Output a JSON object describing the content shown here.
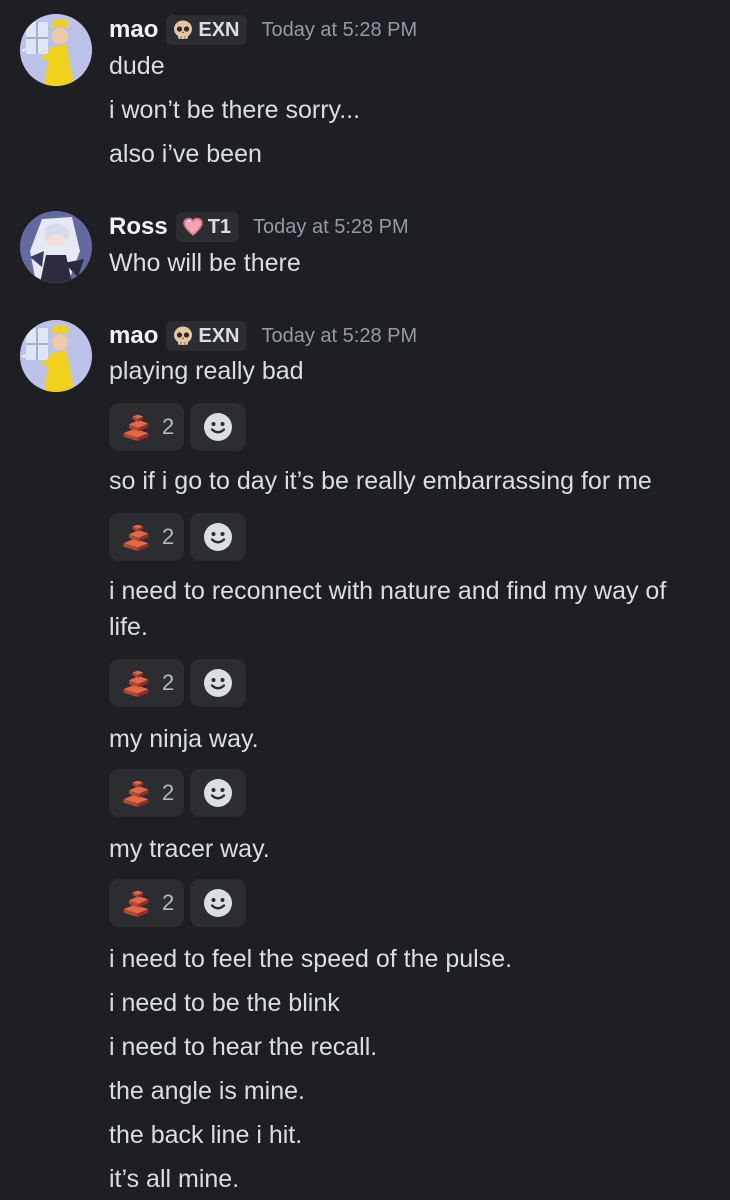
{
  "groups": [
    {
      "username": "mao",
      "tag": "EXN",
      "tag_icon": "skull-icon",
      "timestamp": "Today at 5:28 PM",
      "messages": [
        "dude",
        "i won’t be there sorry...",
        "also i’ve been"
      ]
    },
    {
      "username": "Ross",
      "tag": "T1",
      "tag_icon": "heart-icon",
      "timestamp": "Today at 5:28 PM",
      "messages": [
        "Who will be there"
      ]
    },
    {
      "username": "mao",
      "tag": "EXN",
      "tag_icon": "skull-icon",
      "timestamp": "Today at 5:28 PM",
      "messages": [
        "playing really bad",
        "so if i go to day it’s be really embarrassing for me",
        "i need to reconnect with nature and find my way of life.",
        "my ninja way.",
        "my tracer way.",
        "i need to feel the speed of the pulse.",
        "i need to be the blink",
        "i need to hear the recall.",
        "the angle is mine.",
        "the back line i hit.",
        "it’s all mine."
      ],
      "reactions": [
        {
          "emoji": "bricks-icon",
          "count": "2"
        },
        {
          "emoji": "bricks-icon",
          "count": "2"
        },
        {
          "emoji": "bricks-icon",
          "count": "2"
        },
        {
          "emoji": "bricks-icon",
          "count": "2"
        },
        {
          "emoji": "bricks-icon",
          "count": "2"
        }
      ]
    }
  ],
  "colors": {
    "background": "#1e1f22",
    "text": "#dbdee1",
    "timestamp": "#949ba4",
    "chip": "#2b2d31"
  }
}
